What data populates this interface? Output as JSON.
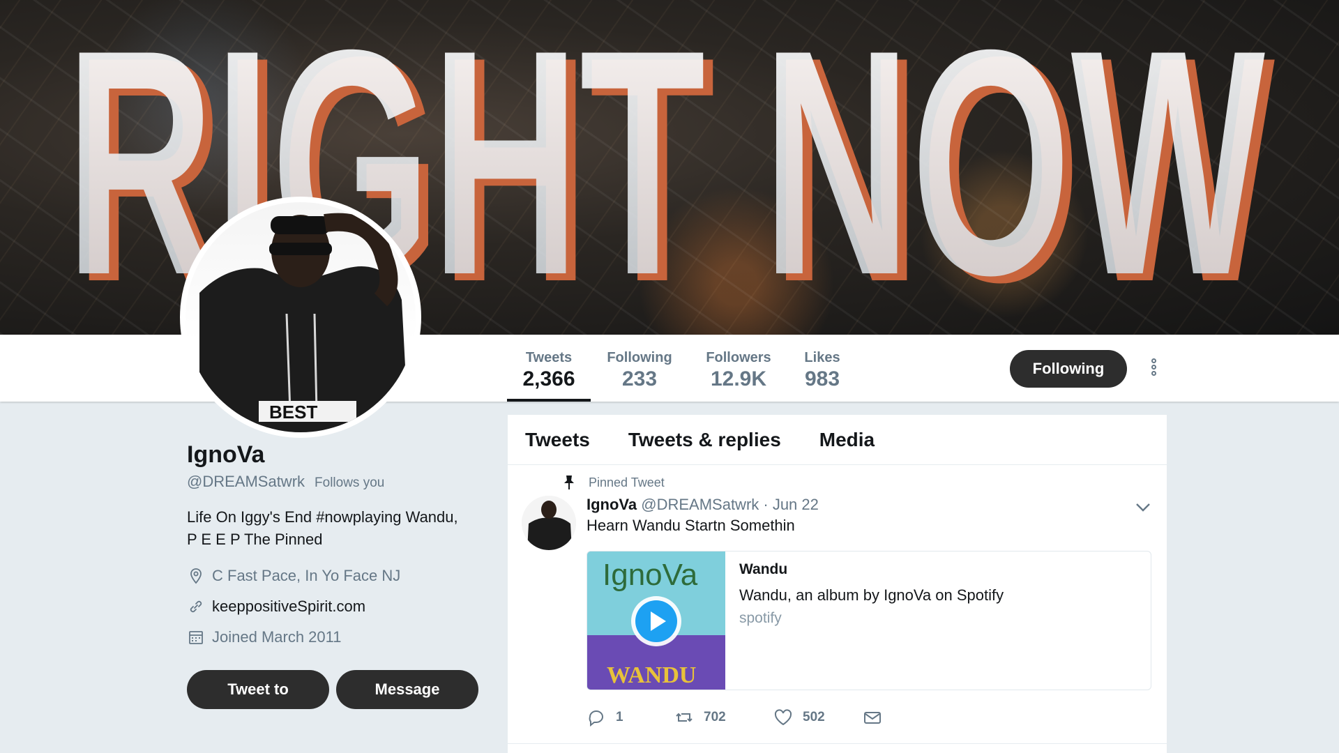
{
  "banner": {
    "headline": "RIGHT NOW"
  },
  "nav": {
    "stats": [
      {
        "label": "Tweets",
        "value": "2,366"
      },
      {
        "label": "Following",
        "value": "233"
      },
      {
        "label": "Followers",
        "value": "12.9K"
      },
      {
        "label": "Likes",
        "value": "983"
      }
    ],
    "follow_button": "Following",
    "more_icon": "more-vertical-icon"
  },
  "profile": {
    "name": "IgnoVa",
    "handle": "@DREAMSatwrk",
    "follows_you": "Follows you",
    "bio_line1": "Life On Iggy's End #nowplaying Wandu,",
    "bio_line2": "P E E P The Pinned",
    "location": "C Fast Pace, In Yo Face NJ",
    "website": "keeppositiveSpirit.com",
    "joined": "Joined March 2011",
    "tweet_to_button": "Tweet to",
    "message_button": "Message",
    "avatar_shirt_text": "BEST"
  },
  "timeline": {
    "tabs": [
      "Tweets",
      "Tweets & replies",
      "Media"
    ],
    "pinned_label": "Pinned Tweet",
    "tweet": {
      "name": "IgnoVa",
      "handle_date": "@DREAMSatwrk · Jun 22",
      "text": "Hearn Wandu Startn Somethin",
      "card": {
        "art_top": "IgnoVa",
        "art_bottom": "WANDU",
        "title": "Wandu",
        "description": "Wandu, an album by IgnoVa on Spotify",
        "domain": "spotify"
      },
      "actions": {
        "replies": "1",
        "retweets": "702",
        "likes": "502"
      }
    }
  },
  "colors": {
    "button_dark": "#2d2d2d",
    "muted": "#657786",
    "banner_accent": "#c8643c"
  }
}
